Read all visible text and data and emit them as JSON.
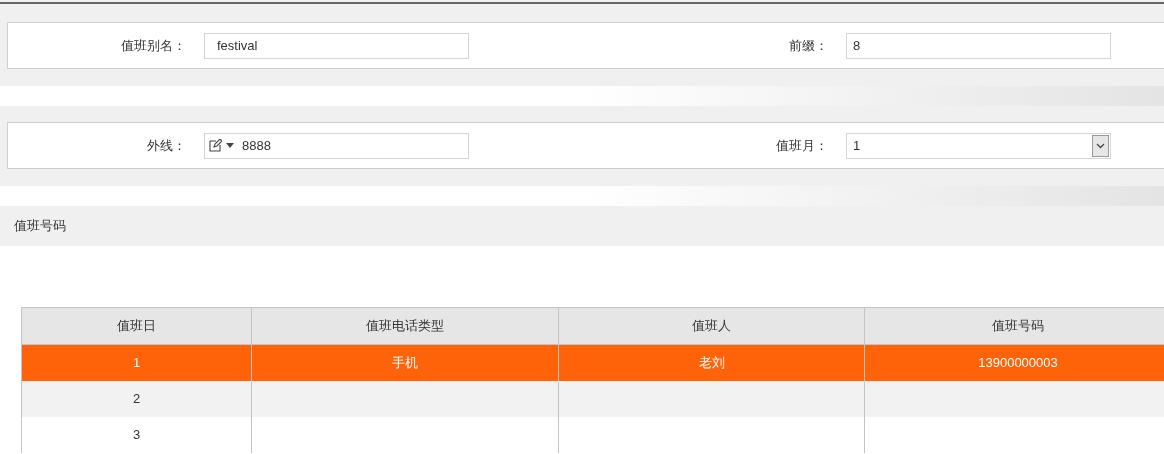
{
  "form_rows": [
    {
      "fields": [
        {
          "label": "值班别名：",
          "kind": "text",
          "value": "festival"
        },
        {
          "label": "前缀：",
          "kind": "text",
          "value": "8"
        }
      ]
    },
    {
      "fields": [
        {
          "label": "外线：",
          "kind": "phone",
          "value": "8888"
        },
        {
          "label": "值班月：",
          "kind": "select",
          "value": "1"
        }
      ]
    }
  ],
  "section": {
    "title": "值班号码"
  },
  "table": {
    "columns": [
      "值班日",
      "值班电话类型",
      "值班人",
      "值班号码"
    ],
    "rows": [
      {
        "cells": [
          "1",
          "手机",
          "老刘",
          "13900000003"
        ],
        "selected": true
      },
      {
        "cells": [
          "2",
          "",
          "",
          ""
        ],
        "selected": false
      },
      {
        "cells": [
          "3",
          "",
          "",
          ""
        ],
        "selected": false
      }
    ]
  }
}
